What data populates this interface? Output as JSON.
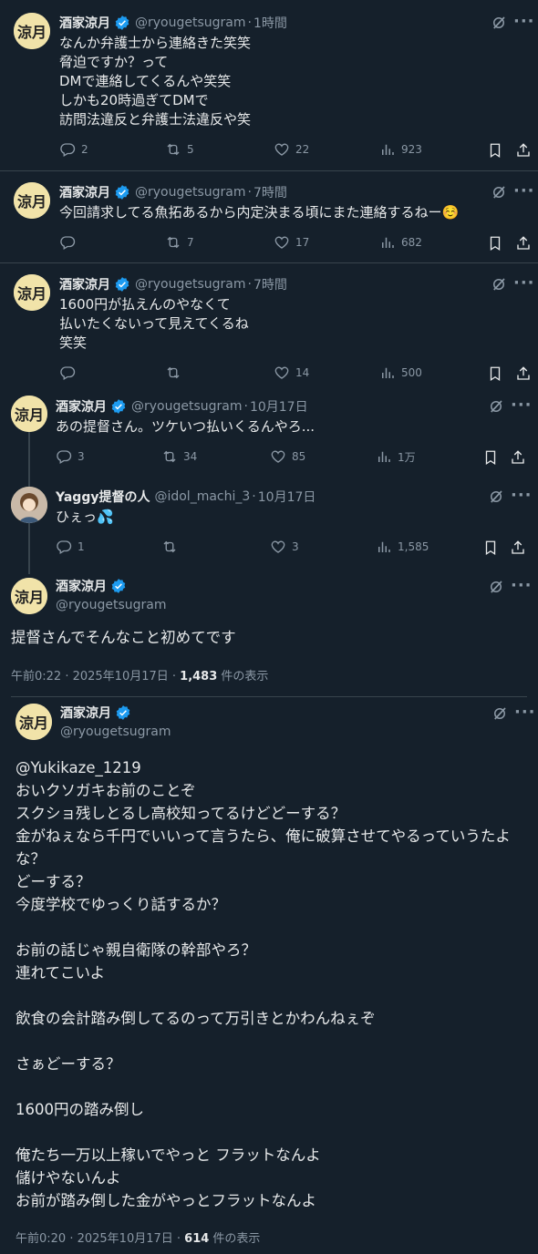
{
  "tweets": [
    {
      "name": "酒家涼月",
      "handle": "@ryougetsugram",
      "time": "1時間",
      "text": "なんか弁護士から連絡きた笑笑\n脅迫ですか？って\nDMで連絡してくるんや笑笑\nしかも20時過ぎてDMで\n訪問法違反と弁護士法違反や笑",
      "replies": "2",
      "retweets": "5",
      "likes": "22",
      "views": "923"
    },
    {
      "name": "酒家涼月",
      "handle": "@ryougetsugram",
      "time": "7時間",
      "text": "今回請求してる魚拓あるから内定決まる頃にまた連絡するねー☺️",
      "replies": "",
      "retweets": "7",
      "likes": "17",
      "views": "682"
    },
    {
      "name": "酒家涼月",
      "handle": "@ryougetsugram",
      "time": "7時間",
      "text": "1600円が払えんのやなくて\n払いたくないって見えてくるね\n笑笑",
      "replies": "",
      "retweets": "",
      "likes": "14",
      "views": "500"
    },
    {
      "name": "酒家涼月",
      "handle": "@ryougetsugram",
      "time": "10月17日",
      "text": "あの提督さん。ツケいつ払いくるんやろ...",
      "replies": "3",
      "retweets": "34",
      "likes": "85",
      "views": "1万"
    },
    {
      "name": "Yaggy提督の人",
      "handle": "@idol_machi_3",
      "time": "10月17日",
      "text": "ひぇっ💦",
      "replies": "1",
      "retweets": "",
      "likes": "3",
      "views": "1,585"
    }
  ],
  "focus": {
    "name": "酒家涼月",
    "handle": "@ryougetsugram",
    "text": "提督さんでそんなこと初めてです",
    "timestamp": "午前0:22 · 2025年10月17日 · ",
    "views_count": "1,483",
    "views_suffix": " 件の表示"
  },
  "quoted": {
    "name": "酒家涼月",
    "handle": "@ryougetsugram",
    "text": "@Yukikaze_1219\nおいクソガキお前のことぞ\nスクショ残しとるし高校知ってるけどどーする？\n金がねぇなら千円でいいって言うたら、俺に破算させてやるっていうたよ\nな？\nどーする？\n今度学校でゆっくり話するか？\n\nお前の話じゃ親自衛隊の幹部やろ？\n連れてこいよ\n\n飲食の会計踏み倒してるのって万引きとかわんねぇぞ\n\nさぁどーする？\n\n1600円の踏み倒し\n\n俺たち一万以上稼いでやっと フラットなんよ\n儲けやないんよ\nお前が踏み倒した金がやっとフラットなんよ",
    "timestamp": "午前0:20 · 2025年10月17日 · ",
    "views_count": "614",
    "views_suffix": " 件の表示"
  },
  "sep_dot": "·",
  "more_glyph": "···",
  "avatar_label": "涼月",
  "colors": {
    "bg": "#15202b",
    "text": "#e7e9ea",
    "muted": "#8b98a5",
    "border": "#38444d",
    "verified": "#1d9bf0"
  }
}
